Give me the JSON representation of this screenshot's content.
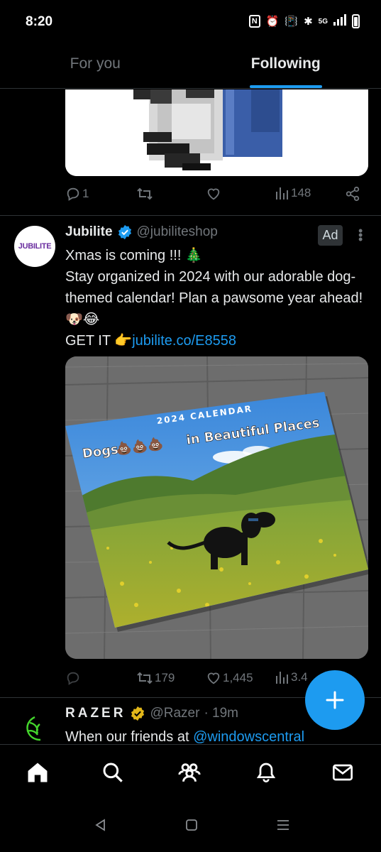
{
  "status_bar": {
    "time": "8:20",
    "network": "5G"
  },
  "tabs": [
    {
      "label": "For you",
      "active": false
    },
    {
      "label": "Following",
      "active": true
    }
  ],
  "prev_tweet": {
    "reply_count": "1",
    "retweet_count": "",
    "like_count": "",
    "view_count": "148"
  },
  "ad_tweet": {
    "name": "Jubilite",
    "verified": true,
    "handle": "@jubiliteshop",
    "ad_label": "Ad",
    "avatar_text": "JUBILITE",
    "line1": "Xmas is coming !!! 🎄",
    "line2": "Stay organized in 2024 with our adorable dog-themed calendar! Plan a pawsome year ahead! 🐶😂",
    "line3_prefix": "GET IT 👉",
    "link": "jubilite.co/E8558",
    "media": {
      "calendar_subtitle": "2024 CALENDAR",
      "calendar_title_left": "Dogs",
      "calendar_emoji": "💩💩💩",
      "calendar_title_right": "in Beautiful Places"
    },
    "reply_count": "",
    "retweet_count": "179",
    "like_count": "1,445",
    "view_count": "3.4"
  },
  "next_tweet": {
    "name": "RAZER",
    "handle": "@Razer",
    "time": "· 19m",
    "text_prefix": "When our friends at ",
    "mention": "@windowscentral"
  },
  "icons": {
    "reply": "reply-icon",
    "retweet": "retweet-icon",
    "like": "heart-icon",
    "views": "views-icon",
    "share": "share-icon",
    "compose": "plus-icon"
  },
  "colors": {
    "accent": "#1d9bf0",
    "background": "#000000",
    "muted": "#71767b",
    "text": "#e7e9ea",
    "divider": "#2f3336",
    "gold_badge": "#e2b719"
  }
}
